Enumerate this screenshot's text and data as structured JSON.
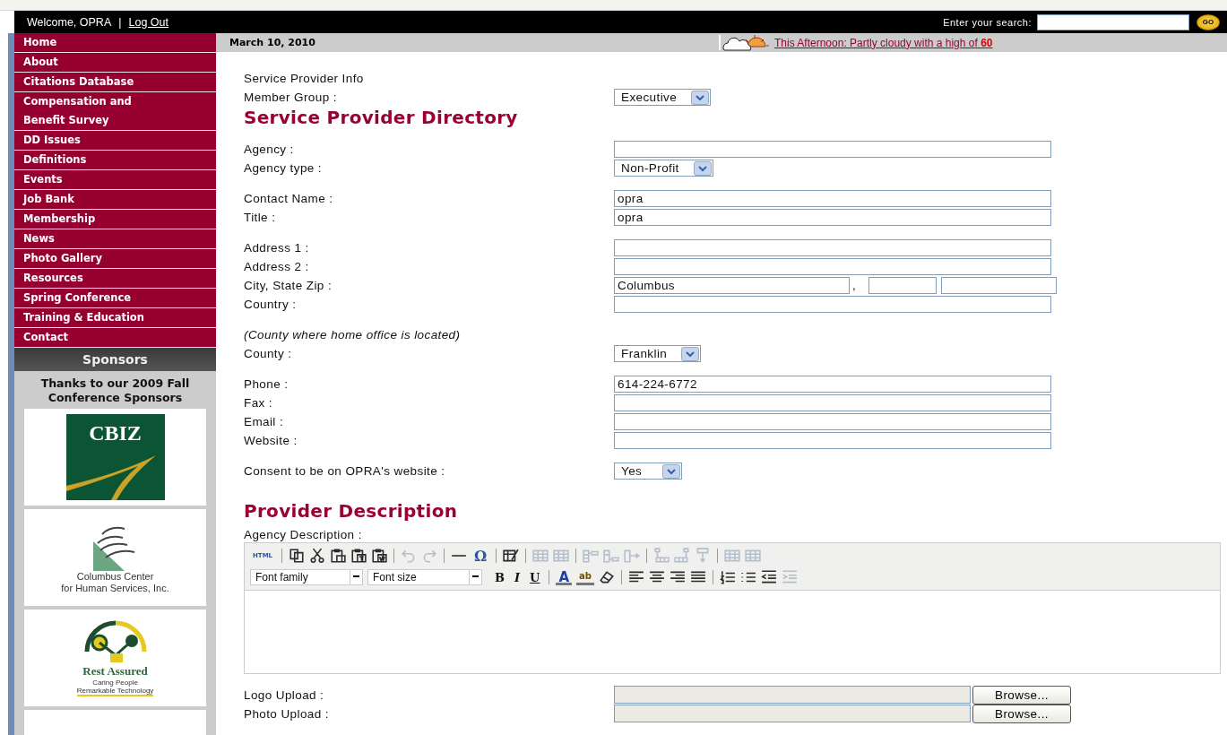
{
  "header": {
    "welcome": "Welcome, OPRA",
    "divider": "|",
    "logout": "Log Out",
    "search_label": "Enter your search:",
    "go": "GO"
  },
  "date": "March 10, 2010",
  "weather": {
    "text": "This Afternoon: Partly cloudy with a high of **60**"
  },
  "nav": [
    {
      "label": "Home"
    },
    {
      "label": "About"
    },
    {
      "label": "Citations Database"
    },
    {
      "label": "Compensation and\nBenefit Survey"
    },
    {
      "label": "DD Issues"
    },
    {
      "label": "Definitions"
    },
    {
      "label": "Events"
    },
    {
      "label": "Job Bank"
    },
    {
      "label": "Membership"
    },
    {
      "label": "News"
    },
    {
      "label": "Photo Gallery"
    },
    {
      "label": "Resources"
    },
    {
      "label": "Spring Conference"
    },
    {
      "label": "Training & Education"
    },
    {
      "label": "Contact"
    }
  ],
  "sponsors": {
    "title": "Sponsors",
    "thanks": "Thanks to our 2009 Fall Conference Sponsors",
    "logos": [
      {
        "kind": "cbiz",
        "lines": [
          "CBIZ"
        ]
      },
      {
        "kind": "columbus",
        "lines": [
          "Columbus Center",
          "for Human Services, Inc."
        ]
      },
      {
        "kind": "rest",
        "lines": [
          "Rest Assured",
          "Caring People",
          "Remarkable Technology"
        ]
      },
      {
        "kind": "blank"
      }
    ]
  },
  "form": {
    "blocks": [
      {
        "kind": "group",
        "rows": [
          {
            "label": "Service Provider Info"
          },
          {
            "label": "Member Group :",
            "field": {
              "kind": "select",
              "value": "Executive"
            }
          }
        ]
      },
      {
        "kind": "heading",
        "text": "Service Provider Directory"
      },
      {
        "kind": "group",
        "rows": [
          {
            "label": "Agency :",
            "field": {
              "kind": "input"
            }
          },
          {
            "label": "Agency type :",
            "field": {
              "kind": "select",
              "value": "Non-Profit"
            }
          }
        ]
      },
      {
        "kind": "group",
        "rows": [
          {
            "label": "Contact Name :",
            "field": {
              "kind": "input",
              "value": "opra"
            }
          },
          {
            "label": "Title :",
            "field": {
              "kind": "input",
              "value": "opra"
            }
          }
        ]
      },
      {
        "kind": "group",
        "rows": [
          {
            "label": "Address 1 :",
            "field": {
              "kind": "input"
            }
          },
          {
            "label": "Address 2 :",
            "field": {
              "kind": "input"
            }
          },
          {
            "label": "City, State Zip :",
            "field": {
              "kind": "city",
              "value": "Columbus",
              "separator": ","
            }
          },
          {
            "label": "Country :",
            "field": {
              "kind": "input"
            }
          }
        ]
      },
      {
        "kind": "group",
        "rows": [
          {
            "note": "(County where home office is located)"
          },
          {
            "label": "County :",
            "field": {
              "kind": "select",
              "value": "Franklin"
            }
          }
        ]
      },
      {
        "kind": "group",
        "rows": [
          {
            "label": "Phone :",
            "field": {
              "kind": "input",
              "value": "614-224-6772"
            }
          },
          {
            "label": "Fax :",
            "field": {
              "kind": "input"
            }
          },
          {
            "label": "Email :",
            "field": {
              "kind": "input"
            }
          },
          {
            "label": "Website :",
            "field": {
              "kind": "input"
            }
          }
        ]
      },
      {
        "kind": "group",
        "rows": [
          {
            "label": "Consent to be on OPRA's website :",
            "field": {
              "kind": "select",
              "value": "Yes"
            }
          }
        ]
      },
      {
        "kind": "heading",
        "text": "Provider Description"
      },
      {
        "kind": "editor",
        "label": "Agency Description :"
      },
      {
        "kind": "group",
        "rows": [
          {
            "label": "Logo Upload :",
            "field": {
              "kind": "file",
              "button": "Browse..."
            }
          },
          {
            "label": "Photo Upload :",
            "field": {
              "kind": "file",
              "button": "Browse..."
            }
          }
        ]
      }
    ]
  },
  "toolbar": {
    "rows": [
      [
        {
          "kind": "html",
          "text": "HTML",
          "disabled": false
        },
        {
          "kind": "separator"
        },
        {
          "kind": "copy",
          "disabled": false
        },
        {
          "kind": "scissors",
          "disabled": false
        },
        {
          "kind": "clipboard",
          "disabled": false
        },
        {
          "kind": "clipboard-lines",
          "disabled": false
        },
        {
          "kind": "clipboard-doc",
          "disabled": false
        },
        {
          "kind": "separator"
        },
        {
          "kind": "undo",
          "disabled": true
        },
        {
          "kind": "redo",
          "disabled": true
        },
        {
          "kind": "separator"
        },
        {
          "kind": "rule",
          "disabled": false
        },
        {
          "kind": "symbol",
          "text": "Ω",
          "disabled": false
        },
        {
          "kind": "separator"
        },
        {
          "kind": "table-edit",
          "disabled": false
        },
        {
          "kind": "separator"
        },
        {
          "kind": "table",
          "disabled": true
        },
        {
          "kind": "table",
          "disabled": true
        },
        {
          "kind": "separator"
        },
        {
          "kind": "column-before",
          "disabled": true
        },
        {
          "kind": "column-after",
          "disabled": true
        },
        {
          "kind": "column-delete",
          "disabled": true
        },
        {
          "kind": "separator"
        },
        {
          "kind": "row-before",
          "disabled": true
        },
        {
          "kind": "row-after",
          "disabled": true
        },
        {
          "kind": "row-delete",
          "disabled": true
        },
        {
          "kind": "separator"
        },
        {
          "kind": "table",
          "disabled": true
        },
        {
          "kind": "table",
          "disabled": true
        }
      ],
      [
        {
          "kind": "dropdown",
          "text": "Font family"
        },
        {
          "kind": "dropdown",
          "text": "Font size"
        },
        {
          "kind": "bold",
          "text": "B",
          "disabled": false
        },
        {
          "kind": "italic",
          "text": "I",
          "disabled": false
        },
        {
          "kind": "underline",
          "text": "U",
          "disabled": false
        },
        {
          "kind": "separator"
        },
        {
          "kind": "text-color",
          "text": "A",
          "disabled": false
        },
        {
          "kind": "highlight",
          "text": "ab",
          "disabled": false
        },
        {
          "kind": "eraser",
          "disabled": false
        },
        {
          "kind": "separator"
        },
        {
          "kind": "align-left",
          "disabled": false
        },
        {
          "kind": "align-center",
          "disabled": false
        },
        {
          "kind": "align-right",
          "disabled": false
        },
        {
          "kind": "align-justify",
          "disabled": false
        },
        {
          "kind": "separator"
        },
        {
          "kind": "numbered-list",
          "disabled": false
        },
        {
          "kind": "bullet-list",
          "disabled": false
        },
        {
          "kind": "outdent",
          "disabled": false
        },
        {
          "kind": "indent",
          "disabled": true
        }
      ]
    ]
  }
}
